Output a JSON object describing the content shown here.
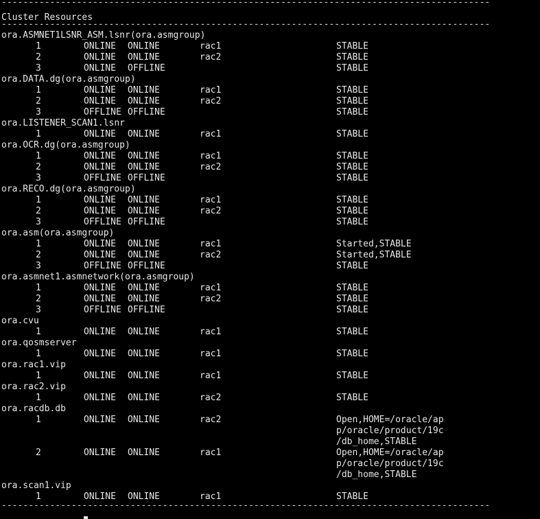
{
  "terminal": {
    "rule": "-------------------------------------------------------------------------------------------",
    "section_title": "Cluster Resources",
    "resources": [
      {
        "name": "ora.ASMNET1LSNR_ASM.lsnr(ora.asmgroup)",
        "rows": [
          [
            "1",
            "ONLINE",
            "ONLINE",
            "rac1",
            [
              "STABLE"
            ]
          ],
          [
            "2",
            "ONLINE",
            "ONLINE",
            "rac2",
            [
              "STABLE"
            ]
          ],
          [
            "3",
            "ONLINE",
            "OFFLINE",
            "",
            [
              "STABLE"
            ]
          ]
        ]
      },
      {
        "name": "ora.DATA.dg(ora.asmgroup)",
        "rows": [
          [
            "1",
            "ONLINE",
            "ONLINE",
            "rac1",
            [
              "STABLE"
            ]
          ],
          [
            "2",
            "ONLINE",
            "ONLINE",
            "rac2",
            [
              "STABLE"
            ]
          ],
          [
            "3",
            "OFFLINE",
            "OFFLINE",
            "",
            [
              "STABLE"
            ]
          ]
        ]
      },
      {
        "name": "ora.LISTENER_SCAN1.lsnr",
        "rows": [
          [
            "1",
            "ONLINE",
            "ONLINE",
            "rac1",
            [
              "STABLE"
            ]
          ]
        ]
      },
      {
        "name": "ora.OCR.dg(ora.asmgroup)",
        "rows": [
          [
            "1",
            "ONLINE",
            "ONLINE",
            "rac1",
            [
              "STABLE"
            ]
          ],
          [
            "2",
            "ONLINE",
            "ONLINE",
            "rac2",
            [
              "STABLE"
            ]
          ],
          [
            "3",
            "OFFLINE",
            "OFFLINE",
            "",
            [
              "STABLE"
            ]
          ]
        ]
      },
      {
        "name": "ora.RECO.dg(ora.asmgroup)",
        "rows": [
          [
            "1",
            "ONLINE",
            "ONLINE",
            "rac1",
            [
              "STABLE"
            ]
          ],
          [
            "2",
            "ONLINE",
            "ONLINE",
            "rac2",
            [
              "STABLE"
            ]
          ],
          [
            "3",
            "OFFLINE",
            "OFFLINE",
            "",
            [
              "STABLE"
            ]
          ]
        ]
      },
      {
        "name": "ora.asm(ora.asmgroup)",
        "rows": [
          [
            "1",
            "ONLINE",
            "ONLINE",
            "rac1",
            [
              "Started,STABLE"
            ]
          ],
          [
            "2",
            "ONLINE",
            "ONLINE",
            "rac2",
            [
              "Started,STABLE"
            ]
          ],
          [
            "3",
            "OFFLINE",
            "OFFLINE",
            "",
            [
              "STABLE"
            ]
          ]
        ]
      },
      {
        "name": "ora.asmnet1.asmnetwork(ora.asmgroup)",
        "rows": [
          [
            "1",
            "ONLINE",
            "ONLINE",
            "rac1",
            [
              "STABLE"
            ]
          ],
          [
            "2",
            "ONLINE",
            "ONLINE",
            "rac2",
            [
              "STABLE"
            ]
          ],
          [
            "3",
            "OFFLINE",
            "OFFLINE",
            "",
            [
              "STABLE"
            ]
          ]
        ]
      },
      {
        "name": "ora.cvu",
        "rows": [
          [
            "1",
            "ONLINE",
            "ONLINE",
            "rac1",
            [
              "STABLE"
            ]
          ]
        ]
      },
      {
        "name": "ora.qosmserver",
        "rows": [
          [
            "1",
            "ONLINE",
            "ONLINE",
            "rac1",
            [
              "STABLE"
            ]
          ]
        ]
      },
      {
        "name": "ora.rac1.vip",
        "rows": [
          [
            "1",
            "ONLINE",
            "ONLINE",
            "rac1",
            [
              "STABLE"
            ]
          ]
        ]
      },
      {
        "name": "ora.rac2.vip",
        "rows": [
          [
            "1",
            "ONLINE",
            "ONLINE",
            "rac2",
            [
              "STABLE"
            ]
          ]
        ]
      },
      {
        "name": "ora.racdb.db",
        "rows": [
          [
            "1",
            "ONLINE",
            "ONLINE",
            "rac2",
            [
              "Open,HOME=/oracle/ap",
              "p/oracle/product/19c",
              "/db_home,STABLE"
            ]
          ],
          [
            "2",
            "ONLINE",
            "ONLINE",
            "rac1",
            [
              "Open,HOME=/oracle/ap",
              "p/oracle/product/19c",
              "/db_home,STABLE"
            ]
          ]
        ]
      },
      {
        "name": "ora.scan1.vip",
        "rows": [
          [
            "1",
            "ONLINE",
            "ONLINE",
            "rac1",
            [
              "STABLE"
            ]
          ]
        ]
      }
    ]
  }
}
